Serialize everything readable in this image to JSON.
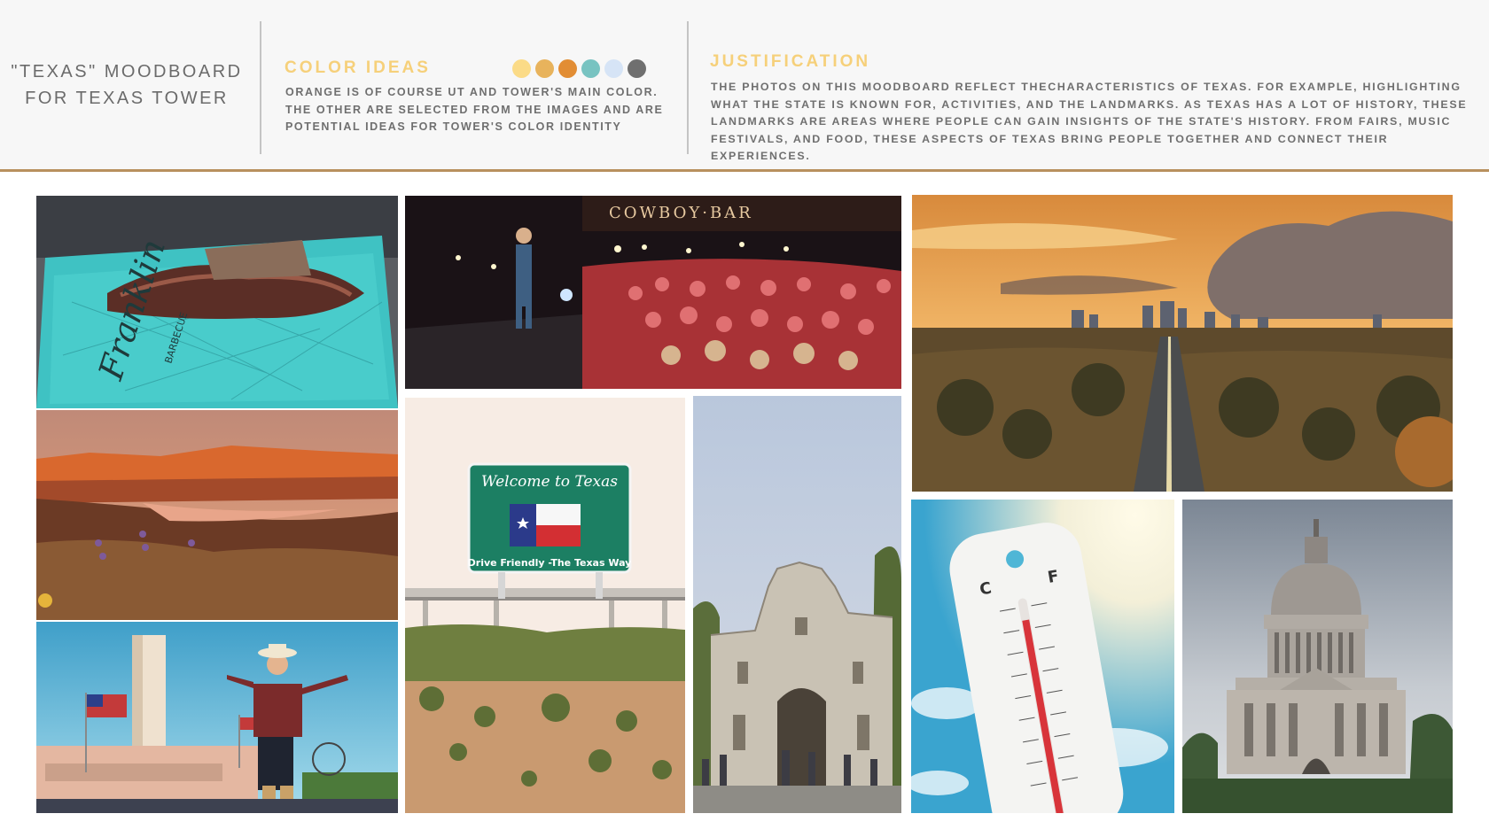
{
  "title": {
    "line1": "\"TEXAS\" MOODBOARD",
    "line2": "FOR TEXAS TOWER"
  },
  "color_ideas": {
    "heading": "COLOR IDEAS",
    "line1": "ORANGE IS OF COURSE UT AND TOWER'S MAIN COLOR.",
    "line2": "THE OTHER ARE SELECTED FROM THE IMAGES AND ARE",
    "line3": "POTENTIAL IDEAS FOR TOWER'S COLOR IDENTITY",
    "swatches": [
      "#fbdb87",
      "#e8b35c",
      "#e28d34",
      "#78c3c1",
      "#d6e4f6",
      "#6f6f6f"
    ]
  },
  "justification": {
    "heading": "JUSTIFICATION",
    "line1": "THE PHOTOS ON THIS MOODBOARD REFLECT THECHARACTERISTICS OF TEXAS. FOR EXAMPLE, HIGHLIGHTING",
    "line2": "WHAT THE STATE IS KNOWN FOR, ACTIVITIES, AND THE LANDMARKS. AS TEXAS HAS A LOT OF HISTORY, THESE",
    "line3": "LANDMARKS ARE AREAS WHERE PEOPLE CAN GAIN INSIGHTS OF THE STATE'S HISTORY. FROM FAIRS, MUSIC",
    "line4": "FESTIVALS, AND FOOD, THESE ASPECTS OF TEXAS BRING PEOPLE TOGETHER AND CONNECT THEIR EXPERIENCES."
  },
  "photos": {
    "bbq_tray_text": "Franklin",
    "bbq_tray_sub": "BARBECUE",
    "concert_sign": "COWBOY·BAR",
    "welcome_sign_line1": "Welcome to Texas",
    "welcome_sign_line2": "Drive Friendly  -The Texas Way",
    "thermo_c": "C",
    "thermo_f": "F"
  }
}
